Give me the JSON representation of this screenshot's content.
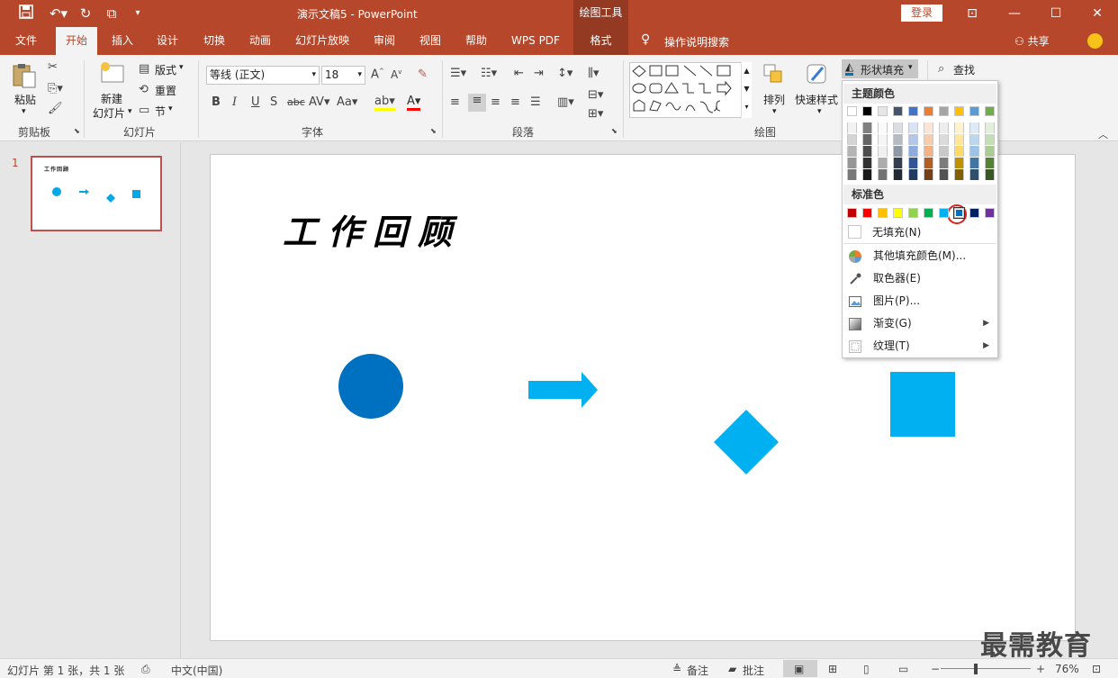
{
  "titlebar": {
    "doc_title": "演示文稿5  -  PowerPoint",
    "context_tool": "绘图工具",
    "login": "登录",
    "qa_icons": [
      "save-icon",
      "undo-icon",
      "redo-icon",
      "slideshow-icon",
      "customize-icon"
    ]
  },
  "tabs": [
    {
      "label": "文件"
    },
    {
      "label": "开始"
    },
    {
      "label": "插入"
    },
    {
      "label": "设计"
    },
    {
      "label": "切换"
    },
    {
      "label": "动画"
    },
    {
      "label": "幻灯片放映"
    },
    {
      "label": "审阅"
    },
    {
      "label": "视图"
    },
    {
      "label": "帮助"
    },
    {
      "label": "WPS PDF"
    },
    {
      "label": "格式"
    }
  ],
  "search_hint": "操作说明搜索",
  "share": "共享",
  "ribbon": {
    "clipboard": {
      "paste": "粘贴",
      "label": "剪贴板"
    },
    "slides": {
      "new_slide_1": "新建",
      "new_slide_2": "幻灯片",
      "layout": "版式",
      "reset": "重置",
      "section": "节",
      "label": "幻灯片"
    },
    "font": {
      "font_name": "等线 (正文)",
      "font_size": "18",
      "label": "字体"
    },
    "paragraph": {
      "label": "段落"
    },
    "drawing": {
      "arrange": "排列",
      "quick_styles": "快速样式",
      "shape_fill": "形状填充",
      "find": "查找",
      "label": "绘图"
    }
  },
  "dropdown": {
    "theme_header": "主题颜色",
    "standard_header": "标准色",
    "no_fill": "无填充(N)",
    "items": [
      {
        "label": "其他填充颜色(M)...",
        "icon": "palette-icon",
        "submenu": false
      },
      {
        "label": "取色器(E)",
        "icon": "eyedropper-icon",
        "submenu": false
      },
      {
        "label": "图片(P)...",
        "icon": "picture-icon",
        "submenu": false
      },
      {
        "label": "渐变(G)",
        "icon": "gradient-icon",
        "submenu": true
      },
      {
        "label": "纹理(T)",
        "icon": "texture-icon",
        "submenu": true
      }
    ],
    "theme_top": [
      "#ffffff",
      "#000000",
      "#e7e6e6",
      "#44546a",
      "#4472c4",
      "#ed7d31",
      "#a5a5a5",
      "#ffc000",
      "#5b9bd5",
      "#70ad47"
    ],
    "standard_colors": [
      "#c00000",
      "#ff0000",
      "#ffc000",
      "#ffff00",
      "#92d050",
      "#00b050",
      "#00b0f0",
      "#0070c0",
      "#002060",
      "#7030a0"
    ],
    "selected_standard_index": 7
  },
  "slide": {
    "title": "工作回顾",
    "thumb_number": "1"
  },
  "statusbar": {
    "slide_info": "幻灯片 第 1 张，共 1 张",
    "language": "中文(中国)",
    "notes": "备注",
    "comments": "批注",
    "zoom": "76%"
  },
  "watermark": "最需教育"
}
